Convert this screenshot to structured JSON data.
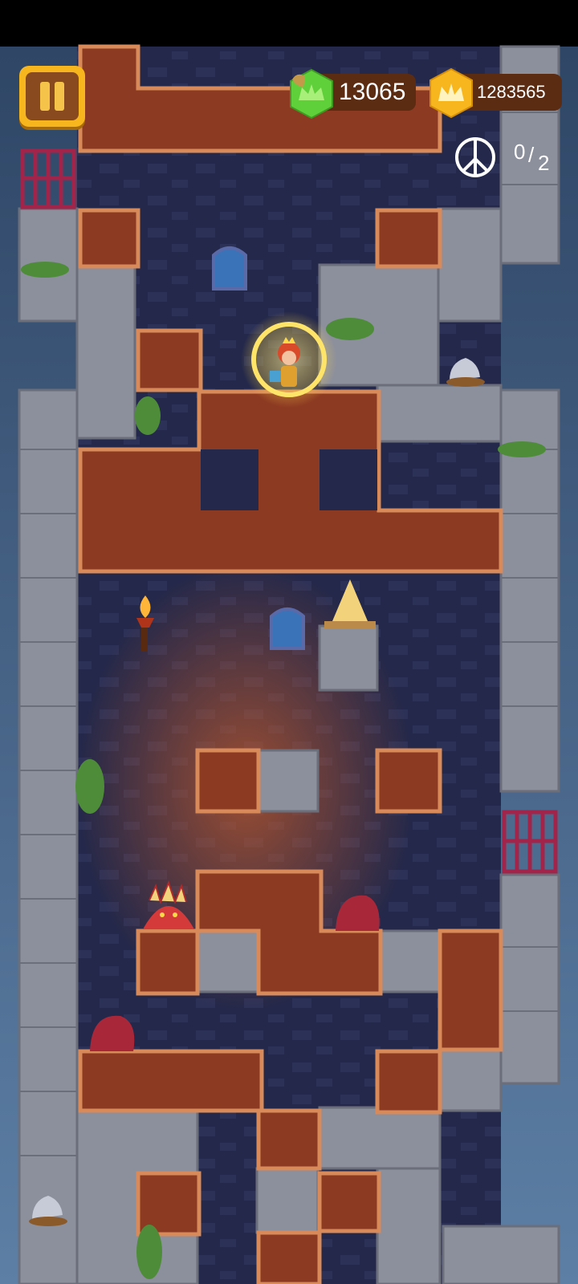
{
  "hud": {
    "pause_label": "Pause",
    "score": "13065",
    "score_icon": "green-crown-shield-icon",
    "coins": "1283565",
    "coins_icon": "gold-crown-coin-icon",
    "peace_icon": "peace-symbol-icon",
    "peace_current": "0",
    "peace_total": "2"
  },
  "colors": {
    "background": "#1f2340",
    "stone": "#8c8f9c",
    "brick": "#8d3a22",
    "brick_border": "#d98a5a",
    "gold": "#f7b61d",
    "green": "#5fcf3a"
  }
}
